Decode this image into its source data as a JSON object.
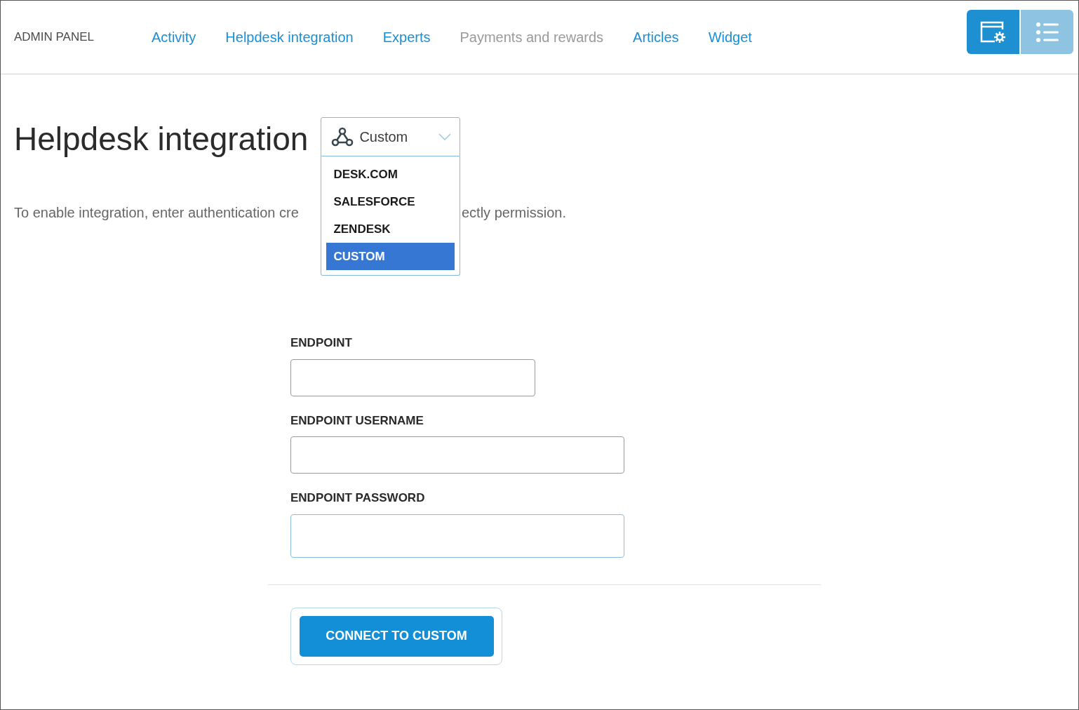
{
  "header": {
    "brand": "ADMIN PANEL",
    "nav": [
      {
        "label": "Activity",
        "disabled": false
      },
      {
        "label": "Helpdesk integration",
        "disabled": false
      },
      {
        "label": "Experts",
        "disabled": false
      },
      {
        "label": "Payments and rewards",
        "disabled": true
      },
      {
        "label": "Articles",
        "disabled": false
      },
      {
        "label": "Widget",
        "disabled": false
      }
    ],
    "view_buttons": [
      {
        "kind": "settings",
        "selected": true
      },
      {
        "kind": "list",
        "selected": false
      }
    ]
  },
  "page": {
    "title": "Helpdesk integration",
    "provider_select": {
      "value": "Custom",
      "expanded": true,
      "options": [
        {
          "label": "DESK.COM",
          "selected": false
        },
        {
          "label": "SALESFORCE",
          "selected": false
        },
        {
          "label": "ZENDESK",
          "selected": false
        },
        {
          "label": "CUSTOM",
          "selected": true
        }
      ]
    },
    "intro_left": "To enable integration, enter authentication cre",
    "intro_right": "ectly permission.",
    "fields": [
      {
        "label": "ENDPOINT",
        "focused": false
      },
      {
        "label": "ENDPOINT USERNAME",
        "focused": false
      },
      {
        "label": "ENDPOINT PASSWORD",
        "focused": true
      }
    ],
    "submit": "CONNECT TO CUSTOM"
  }
}
